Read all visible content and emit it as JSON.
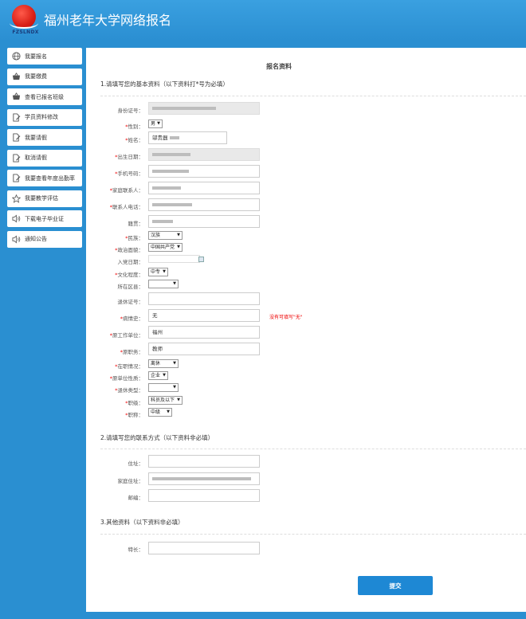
{
  "header": {
    "logo_text": "FZSLNDX",
    "title": "福州老年大学网络报名"
  },
  "sidebar": {
    "items": [
      {
        "label": "我要报名",
        "icon": "globe-icon"
      },
      {
        "label": "我要缴费",
        "icon": "cart-icon"
      },
      {
        "label": "查看已报名班级",
        "icon": "cart-icon"
      },
      {
        "label": "学员资料修改",
        "icon": "document-edit-icon"
      },
      {
        "label": "我要请假",
        "icon": "document-edit-icon"
      },
      {
        "label": "取消请假",
        "icon": "document-edit-icon"
      },
      {
        "label": "我要查看年度出勤率",
        "icon": "document-edit-icon"
      },
      {
        "label": "我要教学评估",
        "icon": "star-icon"
      },
      {
        "label": "下载电子毕业证",
        "icon": "speaker-icon"
      },
      {
        "label": "通知公告",
        "icon": "speaker-icon"
      }
    ]
  },
  "main": {
    "title": "报名资料",
    "section1": "1.请填写您的基本资料（以下资料打*号为必填）",
    "section2": "2.请填写您的联系方式（以下资料非必填）",
    "section3": "3.其他资料（以下资料非必填）",
    "submit": "提交"
  },
  "fields": {
    "id_label": "身份证号：",
    "gender_label": "性别：",
    "gender_value": "男",
    "name_label": "姓名：",
    "name_value": "邬贵器",
    "birth_label": "出生日期：",
    "mobile_label": "手机号码：",
    "family_contact_label": "家庭联系人：",
    "contact_phone_label": "联系人电话：",
    "native_place_label": "籍贯：",
    "ethnic_label": "民族：",
    "ethnic_value": "汉族",
    "political_label": "政治面貌：",
    "political_value": "中国共产党",
    "join_date_label": "入党日期：",
    "education_label": "文化程度：",
    "education_value": "中专",
    "district_label": "所在区县：",
    "veteran_label": "退休证号：",
    "medical_label": "病情史：",
    "medical_value": "无",
    "medical_hint": "没有可填写\"无\"",
    "work_unit_label": "原工作单位：",
    "work_unit_value": "福州",
    "position_label": "原职务：",
    "position_value": "教师",
    "employment_label": "在职情况：",
    "employment_value": "离休",
    "unit_nature_label": "原单位性质：",
    "unit_nature_value": "企业",
    "retire_type_label": "退休类型：",
    "rank_label": "职级：",
    "rank_value": "科员及以下",
    "title_label": "职称：",
    "title_value": "中级",
    "residence_label": "住址：",
    "home_address_label": "家庭住址：",
    "postal_label": "邮编：",
    "remark_label": "特长："
  },
  "colors": {
    "header": "#2b8fd2",
    "required": "#e00000",
    "button": "#1e88d4"
  }
}
